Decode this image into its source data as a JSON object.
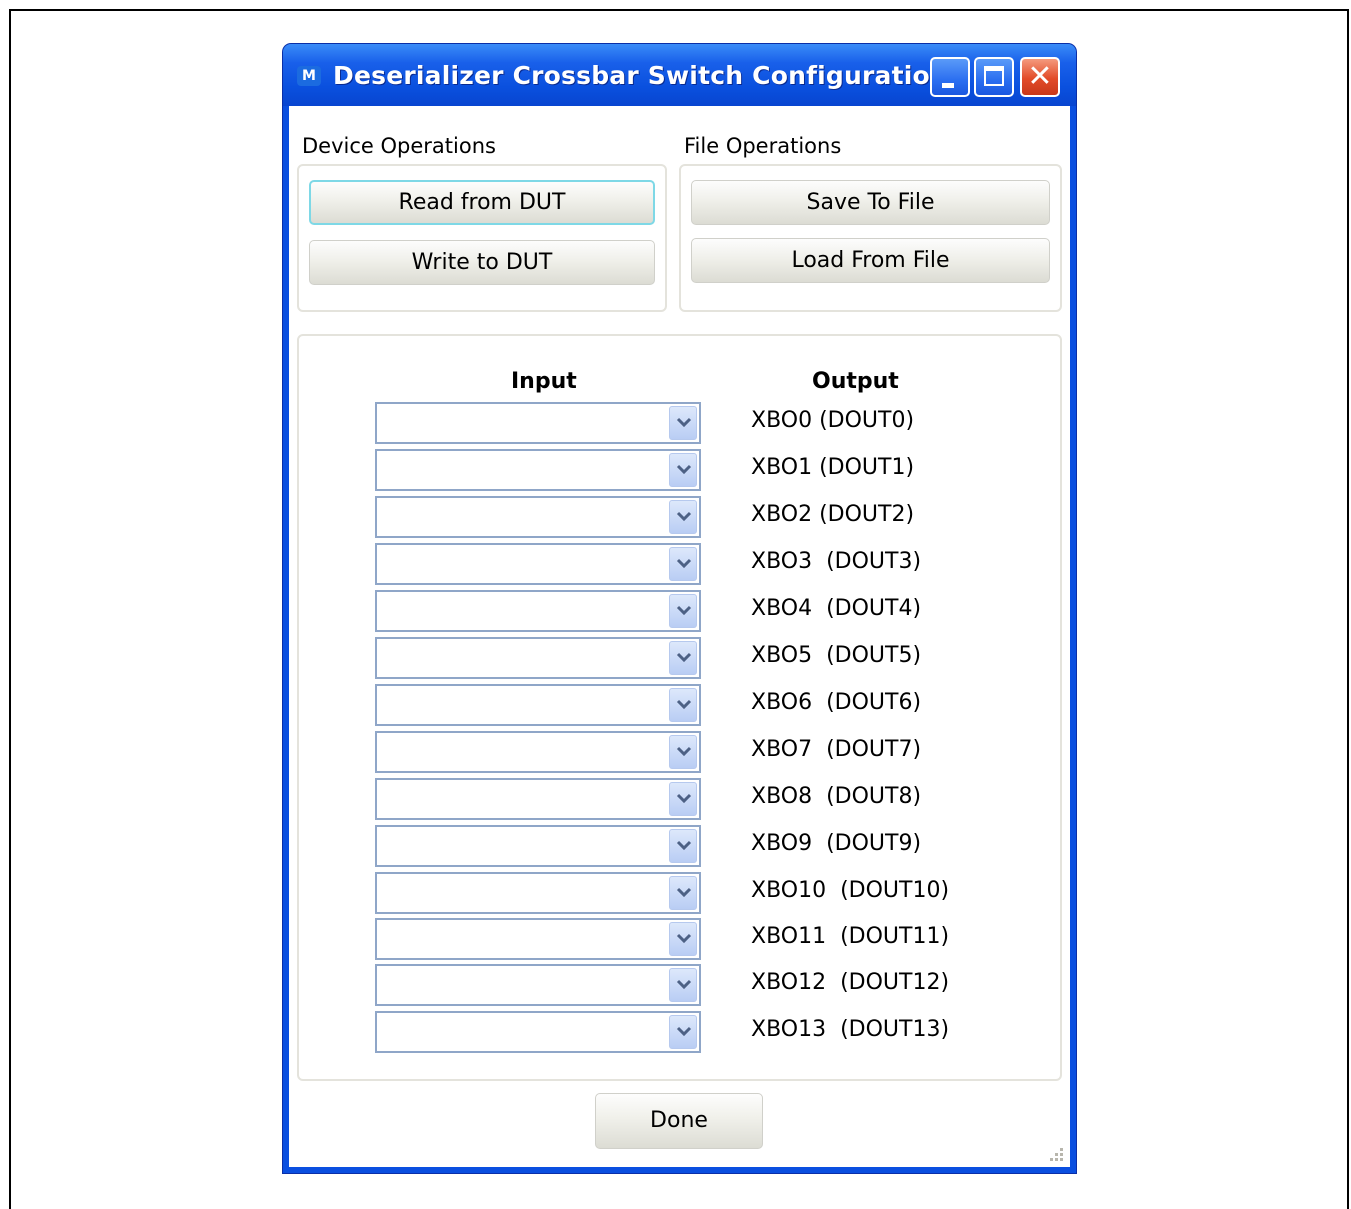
{
  "window": {
    "title": "Deserializer Crossbar Switch Configuration",
    "app_icon_glyph": "M"
  },
  "device_operations": {
    "label": "Device Operations",
    "read_button": "Read from DUT",
    "write_button": "Write to DUT"
  },
  "file_operations": {
    "label": "File Operations",
    "save_button": "Save To File",
    "load_button": "Load From File"
  },
  "mapping": {
    "input_header": "Input",
    "output_header": "Output",
    "rows": [
      {
        "input": "",
        "output": "XBO0 (DOUT0)"
      },
      {
        "input": "",
        "output": "XBO1 (DOUT1)"
      },
      {
        "input": "",
        "output": "XBO2 (DOUT2)"
      },
      {
        "input": "",
        "output": "XBO3  (DOUT3)"
      },
      {
        "input": "",
        "output": "XBO4  (DOUT4)"
      },
      {
        "input": "",
        "output": "XBO5  (DOUT5)"
      },
      {
        "input": "",
        "output": "XBO6  (DOUT6)"
      },
      {
        "input": "",
        "output": "XBO7  (DOUT7)"
      },
      {
        "input": "",
        "output": "XBO8  (DOUT8)"
      },
      {
        "input": "",
        "output": "XBO9  (DOUT9)"
      },
      {
        "input": "",
        "output": "XBO10  (DOUT10)"
      },
      {
        "input": "",
        "output": "XBO11  (DOUT11)"
      },
      {
        "input": "",
        "output": "XBO12  (DOUT12)"
      },
      {
        "input": "",
        "output": "XBO13  (DOUT13)"
      }
    ]
  },
  "footer": {
    "done_button": "Done"
  },
  "colors": {
    "titlebar": "#0a50de",
    "close_button": "#e24b28",
    "combo_border": "#8fa6c8"
  }
}
